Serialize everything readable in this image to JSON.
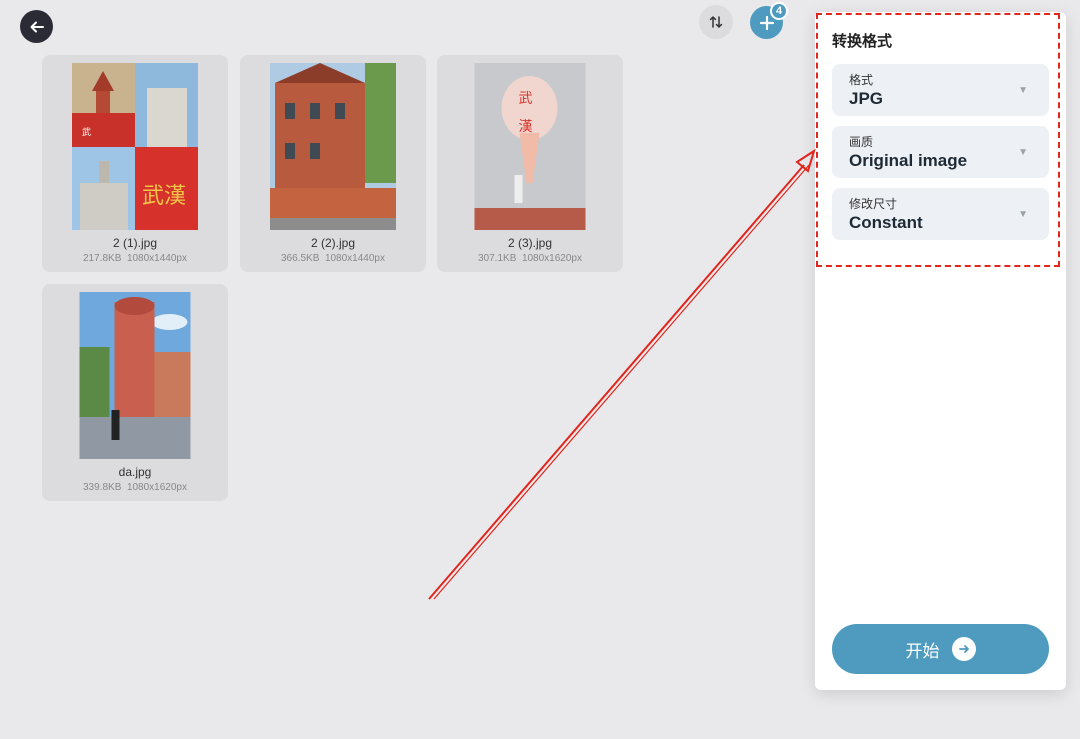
{
  "toolbar": {
    "back_icon": "arrow-left-icon",
    "sort_icon": "sort-arrows-icon",
    "add_icon": "plus-icon",
    "add_badge": "4"
  },
  "files": [
    {
      "name": "2 (1).jpg",
      "size": "217.8KB",
      "dims": "1080x1440px"
    },
    {
      "name": "2 (2).jpg",
      "size": "366.5KB",
      "dims": "1080x1440px"
    },
    {
      "name": "2 (3).jpg",
      "size": "307.1KB",
      "dims": "1080x1620px"
    },
    {
      "name": "da.jpg",
      "size": "339.8KB",
      "dims": "1080x1620px"
    }
  ],
  "panel": {
    "title": "转换格式",
    "format": {
      "label": "格式",
      "value": "JPG"
    },
    "quality": {
      "label": "画质",
      "value": "Original image"
    },
    "resize": {
      "label": "修改尺寸",
      "value": "Constant"
    },
    "start_label": "开始"
  },
  "colors": {
    "accent": "#4e9bbf",
    "highlight": "#e0261d",
    "background": "#e9e9eb"
  }
}
